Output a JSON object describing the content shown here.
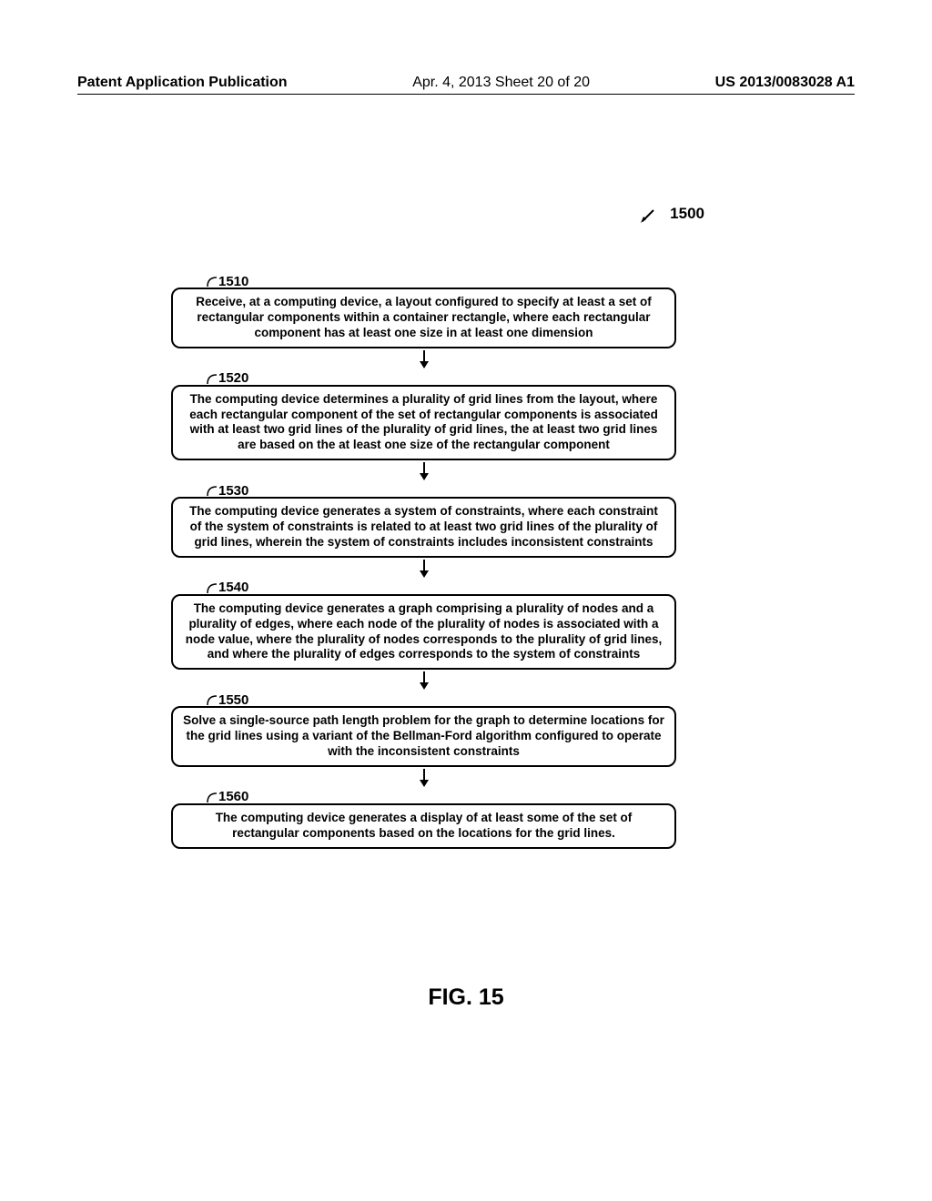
{
  "header": {
    "left": "Patent Application Publication",
    "center": "Apr. 4, 2013  Sheet 20 of 20",
    "right": "US 2013/0083028 A1"
  },
  "figure": {
    "main_label": "1500",
    "caption": "FIG. 15"
  },
  "boxes": [
    {
      "label": "1510",
      "text": "Receive, at a computing device, a layout configured to specify at least a set of rectangular components within a container rectangle, where each rectangular component has at least one size in at least one dimension"
    },
    {
      "label": "1520",
      "text": "The computing device determines a plurality of grid lines from the layout, where each rectangular component of the set of rectangular components is associated with at least two grid lines of the plurality of grid lines, the at least two grid lines are based on the at least one size of the rectangular component"
    },
    {
      "label": "1530",
      "text": "The computing device generates a system of constraints, where each constraint of the system of constraints is related to at least two grid lines of the plurality of grid lines, wherein the system of constraints includes inconsistent constraints"
    },
    {
      "label": "1540",
      "text": "The computing device generates a graph comprising a plurality of nodes and a plurality of edges, where each node of the plurality of nodes is associated with a node value, where the plurality of nodes corresponds to the plurality of grid lines, and where the plurality of edges corresponds to the system of constraints"
    },
    {
      "label": "1550",
      "text": "Solve a single-source path length problem for the graph to determine locations for the grid lines using a variant of the Bellman-Ford algorithm configured to operate with the inconsistent constraints"
    },
    {
      "label": "1560",
      "text": "The computing device generates a display of at least some of the set of rectangular components based on the locations for the grid lines."
    }
  ]
}
